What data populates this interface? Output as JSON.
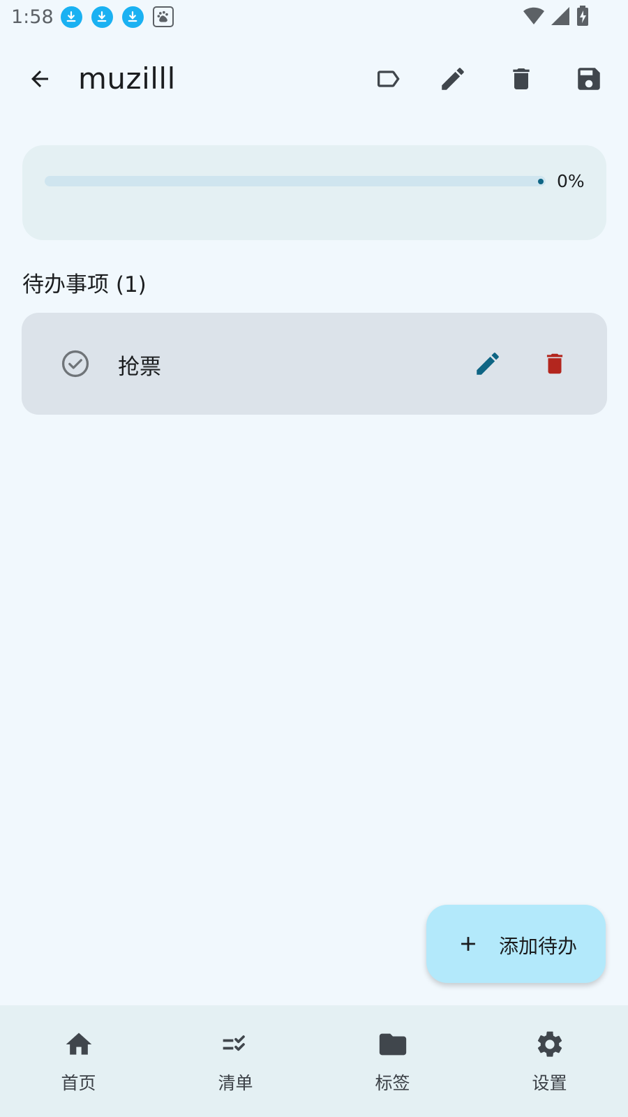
{
  "status_bar": {
    "time": "1:58",
    "notification_icons": [
      "download-icon",
      "download-icon",
      "download-icon",
      "baidu-icon"
    ],
    "right_icons": [
      "wifi-icon",
      "cell-signal-icon",
      "battery-charging-icon"
    ]
  },
  "app_bar": {
    "title": "muzilll",
    "actions": [
      "label-icon",
      "edit-icon",
      "delete-icon",
      "save-icon"
    ]
  },
  "progress": {
    "value": 0,
    "label": "0%"
  },
  "section": {
    "title": "待办事项 (1)"
  },
  "todos": [
    {
      "text": "抢票",
      "done": false
    }
  ],
  "fab": {
    "label": "添加待办",
    "icon": "add-icon"
  },
  "bottom_nav": {
    "items": [
      {
        "label": "首页",
        "icon": "home-icon"
      },
      {
        "label": "清单",
        "icon": "checklist-icon"
      },
      {
        "label": "标签",
        "icon": "folder-icon"
      },
      {
        "label": "设置",
        "icon": "settings-icon"
      }
    ]
  },
  "colors": {
    "background": "#f1f8fd",
    "accent": "#0f6584",
    "danger": "#b3261e",
    "fab": "#b3e9fb",
    "card": "#e4f0f3",
    "todo_card": "#dce3ea"
  }
}
